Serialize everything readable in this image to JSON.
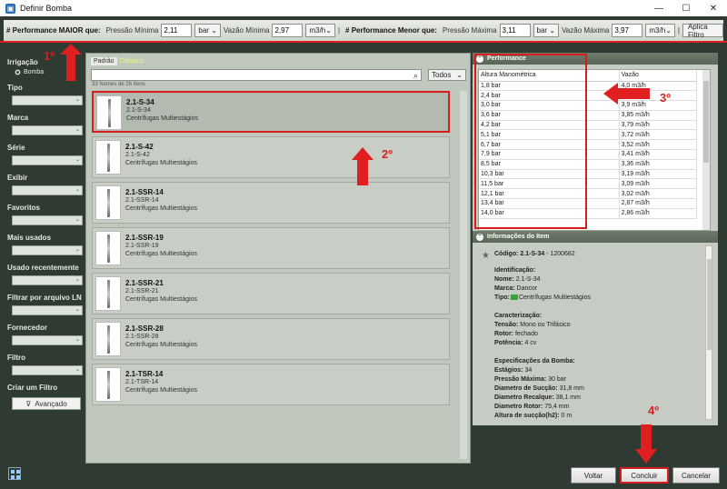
{
  "window": {
    "title": "Definir Bomba",
    "buttons": [
      "—",
      "☐",
      "✕"
    ]
  },
  "filterbar": {
    "maior_label": "# Performance MAIOR que:",
    "pressao_min_label": "Pressão Mínima",
    "pressao_min_value": "2,11",
    "pressao_min_unit": "bar",
    "vazao_min_label": "Vazão Mínima",
    "vazao_min_value": "2,97",
    "vazao_min_unit": "m3/h",
    "separator": "|",
    "menor_label": "# Performance Menor que:",
    "pressao_max_label": "Pressão Máxima",
    "pressao_max_value": "3,11",
    "pressao_max_unit": "bar",
    "vazao_max_label": "Vazão Máxima",
    "vazao_max_value": "3,97",
    "vazao_max_unit": "m3/h",
    "apply_label": "Aplica Filtro"
  },
  "annotations": [
    "1º",
    "2º",
    "3º",
    "4º"
  ],
  "sidebar": {
    "irrigacao": "Irrigação",
    "radio_bomba": "Bomba",
    "sections": [
      "Tipo",
      "Marca",
      "Série",
      "Exibir",
      "Favoritos",
      "Mais usados",
      "Usado recentemente",
      "Filtrar por arquivo LN",
      "Fornecedor",
      "Filtro"
    ],
    "criar_filtro": "Criar um Filtro",
    "avancado": "Avançado"
  },
  "center": {
    "tab_padrao": "Padrão",
    "tab_classico": "Clássico",
    "search_value": "",
    "todos": "Todos",
    "count": "33 Nomes de 26 Itens",
    "items": [
      {
        "name": "2.1-S-34",
        "code": "2.1-S-34",
        "category": "Centrífugas Multiestágios"
      },
      {
        "name": "2.1-S-42",
        "code": "2.1-S-42",
        "category": "Centrífugas Multiestágios"
      },
      {
        "name": "2.1-SSR-14",
        "code": "2.1-SSR-14",
        "category": "Centrífugas Multiestágios"
      },
      {
        "name": "2.1-SSR-19",
        "code": "2.1-SSR-19",
        "category": "Centrífugas Multiestágios"
      },
      {
        "name": "2.1-SSR-21",
        "code": "2.1-SSR-21",
        "category": "Centrífugas Multiestágios"
      },
      {
        "name": "2.1-SSR-28",
        "code": "2.1-SSR-28",
        "category": "Centrífugas Multiestágios"
      },
      {
        "name": "2.1-TSR-14",
        "code": "2.1-TSR-14",
        "category": "Centrífugas Multiestágios"
      }
    ]
  },
  "performance": {
    "title": "Performance",
    "col1": "Altura Manométrica",
    "col2": "Vazão",
    "rows": [
      [
        "1,8 bar",
        "4,0 m3/h"
      ],
      [
        "2,4 bar",
        "3,98 m3/h"
      ],
      [
        "3,0 bar",
        "3,9 m3/h"
      ],
      [
        "3,6 bar",
        "3,85 m3/h"
      ],
      [
        "4,2 bar",
        "3,79 m3/h"
      ],
      [
        "5,1 bar",
        "3,72 m3/h"
      ],
      [
        "6,7 bar",
        "3,52 m3/h"
      ],
      [
        "7,9 bar",
        "3,41 m3/h"
      ],
      [
        "8,5 bar",
        "3,36 m3/h"
      ],
      [
        "10,3 bar",
        "3,19 m3/h"
      ],
      [
        "11,5 bar",
        "3,09 m3/h"
      ],
      [
        "12,1 bar",
        "3,02 m3/h"
      ],
      [
        "13,4 bar",
        "2,87 m3/h"
      ],
      [
        "14,0 bar",
        "2,86 m3/h"
      ]
    ]
  },
  "info": {
    "title": "Informações do Item",
    "codigo_label": "Código:",
    "codigo_value": "2.1-S-34",
    "codigo_id": " - 1200682",
    "identificacao": "Identificação:",
    "nome_label": "Nome:",
    "nome_value": " 2.1-S-34",
    "marca_label": "Marca:",
    "marca_value": " Dancor",
    "tipo_label": "Tipo:",
    "tipo_value": "Centrífugas Multiestágios",
    "caracterizacao": "Caracterização:",
    "tensao_label": "Tensão:",
    "tensao_value": " Mono ou Trifásico",
    "rotor_label": "Rotor:",
    "rotor_value": " fechado",
    "potencia_label": "Potência:",
    "potencia_value": " 4 cv",
    "especificacoes": "Especificações da Bomba:",
    "estagios_label": "Estágios:",
    "estagios_value": " 34",
    "pressao_max_label": "Pressão Máxima:",
    "pressao_max_value": " 30 bar",
    "diam_succao_label": "Diametro de Sucção:",
    "diam_succao_value": " 31,8 mm",
    "diam_recalque_label": "Diametro Recalque:",
    "diam_recalque_value": " 38,1 mm",
    "diam_rotor_label": "Diametro Rotor:",
    "diam_rotor_value": " 75,4 mm",
    "altura_succao_label": "Altura de sucção(h2):",
    "altura_succao_value": " 0 m"
  },
  "footer": {
    "voltar": "Voltar",
    "concluir": "Concluir",
    "cancelar": "Cancelar"
  }
}
